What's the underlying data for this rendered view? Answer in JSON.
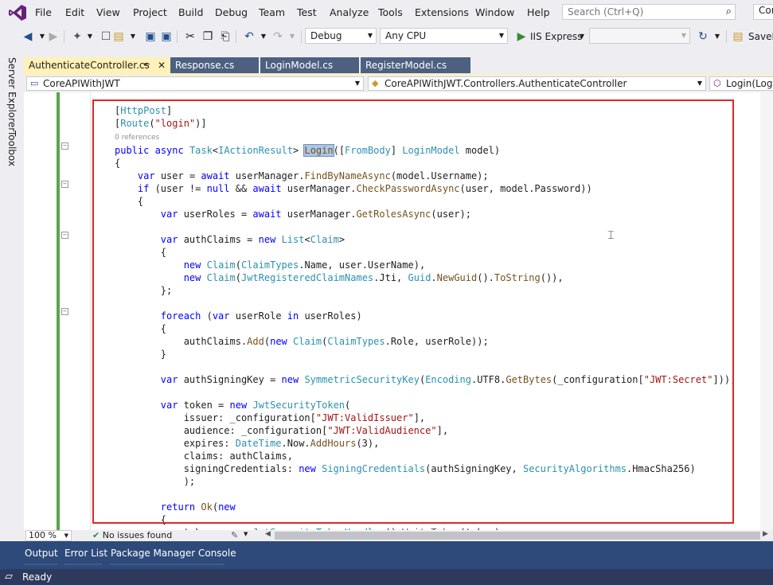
{
  "menu": [
    "File",
    "Edit",
    "View",
    "Project",
    "Build",
    "Debug",
    "Team",
    "Test",
    "Analyze",
    "Tools",
    "Extensions",
    "Window",
    "Help"
  ],
  "search": {
    "placeholder": "Search (Ctrl+Q)"
  },
  "profile_label": "Cor",
  "toolbar": {
    "config": "Debug",
    "platform": "Any CPU",
    "run_label": "IIS Express",
    "save_label": "SaveE"
  },
  "side_tabs": {
    "server_explorer": "Server Explorer",
    "toolbox": "Toolbox"
  },
  "tabs": [
    {
      "label": "AuthenticateController.cs",
      "active": true
    },
    {
      "label": "Response.cs",
      "active": false
    },
    {
      "label": "LoginModel.cs",
      "active": false
    },
    {
      "label": "RegisterModel.cs",
      "active": false
    }
  ],
  "nav": {
    "project": "CoreAPIWithJWT",
    "class": "CoreAPIWithJWT.Controllers.AuthenticateController",
    "member": "Login(Login"
  },
  "code": {
    "references": "0 references"
  },
  "footer": {
    "zoom": "100 %",
    "issues": "No issues found"
  },
  "bottom_tabs": [
    "Output",
    "Error List",
    "Package Manager Console"
  ],
  "status": {
    "text": "Ready"
  },
  "colors": {
    "accent": "#68217a",
    "status_bar": "#2d3a5e",
    "highlight_box": "#e02727",
    "active_tab": "#fff1b7"
  }
}
